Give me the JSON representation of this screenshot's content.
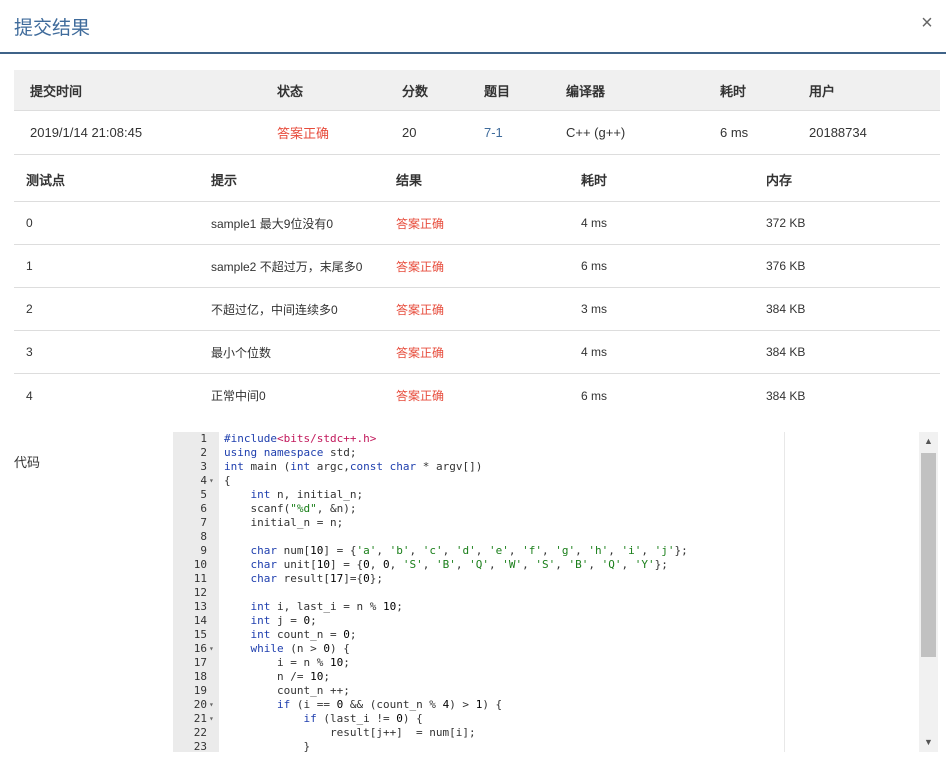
{
  "modal": {
    "title": "提交结果",
    "close_glyph": "×"
  },
  "summary": {
    "headers": [
      "提交时间",
      "状态",
      "分数",
      "题目",
      "编译器",
      "耗时",
      "用户"
    ],
    "row": {
      "time": "2019/1/14 21:08:45",
      "status": "答案正确",
      "score": "20",
      "problem": "7-1",
      "compiler": "C++ (g++)",
      "duration": "6 ms",
      "user": "20188734"
    }
  },
  "tests": {
    "headers": [
      "测试点",
      "提示",
      "结果",
      "耗时",
      "内存"
    ],
    "rows": [
      {
        "id": "0",
        "hint": "sample1 最大9位没有0",
        "result": "答案正确",
        "time": "4 ms",
        "memory": "372 KB"
      },
      {
        "id": "1",
        "hint": "sample2 不超过万，末尾多0",
        "result": "答案正确",
        "time": "6 ms",
        "memory": "376 KB"
      },
      {
        "id": "2",
        "hint": "不超过亿，中间连续多0",
        "result": "答案正确",
        "time": "3 ms",
        "memory": "384 KB"
      },
      {
        "id": "3",
        "hint": "最小个位数",
        "result": "答案正确",
        "time": "4 ms",
        "memory": "384 KB"
      },
      {
        "id": "4",
        "hint": "正常中间0",
        "result": "答案正确",
        "time": "6 ms",
        "memory": "384 KB"
      }
    ]
  },
  "code": {
    "label": "代码",
    "lines": [
      "#include<bits/stdc++.h>",
      "using namespace std;",
      "int main (int argc,const char * argv[])",
      "{",
      "    int n, initial_n;",
      "    scanf(\"%d\", &n);",
      "    initial_n = n;",
      "",
      "    char num[10] = {'a', 'b', 'c', 'd', 'e', 'f', 'g', 'h', 'i', 'j'};",
      "    char unit[10] = {0, 0, 'S', 'B', 'Q', 'W', 'S', 'B', 'Q', 'Y'};",
      "    char result[17]={0};",
      "",
      "    int i, last_i = n % 10;",
      "    int j = 0;",
      "    int count_n = 0;",
      "    while (n > 0) {",
      "        i = n % 10;",
      "        n /= 10;",
      "        count_n ++;",
      "        if (i == 0 && (count_n % 4) > 1) {",
      "            if (last_i != 0) {",
      "                result[j++]  = num[i];",
      "            }"
    ],
    "foldable_lines": [
      4,
      16,
      20,
      21
    ]
  },
  "colors": {
    "accent": "#3f6b9b",
    "correct": "#e74c3c",
    "header_rule": "#3f6388"
  }
}
